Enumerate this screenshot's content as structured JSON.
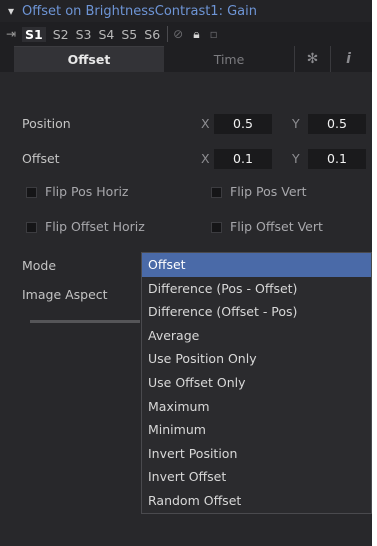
{
  "header": {
    "title": "Offset on BrightnessContrast1: Gain"
  },
  "versions": {
    "items": [
      "S1",
      "S2",
      "S3",
      "S4",
      "S5",
      "S6"
    ],
    "selected": "S1"
  },
  "tabs": {
    "items": [
      "Offset",
      "Time"
    ],
    "active": "Offset"
  },
  "position": {
    "label": "Position",
    "x_label": "X",
    "x_value": "0.5",
    "y_label": "Y",
    "y_value": "0.5"
  },
  "offset": {
    "label": "Offset",
    "x_label": "X",
    "x_value": "0.1",
    "y_label": "Y",
    "y_value": "0.1"
  },
  "checkboxes": {
    "flip_pos_horiz": "Flip Pos Horiz",
    "flip_pos_vert": "Flip Pos Vert",
    "flip_offset_horiz": "Flip Offset Horiz",
    "flip_offset_vert": "Flip Offset Vert"
  },
  "mode": {
    "label": "Mode",
    "selected": "Offset"
  },
  "image_aspect": {
    "label": "Image Aspect"
  },
  "dropdown": {
    "options": [
      "Offset",
      "Difference (Pos - Offset)",
      "Difference (Offset - Pos)",
      "Average",
      "Use Position Only",
      "Use Offset Only",
      "Maximum",
      "Minimum",
      "Invert Position",
      "Invert Offset",
      "Random Offset"
    ]
  }
}
